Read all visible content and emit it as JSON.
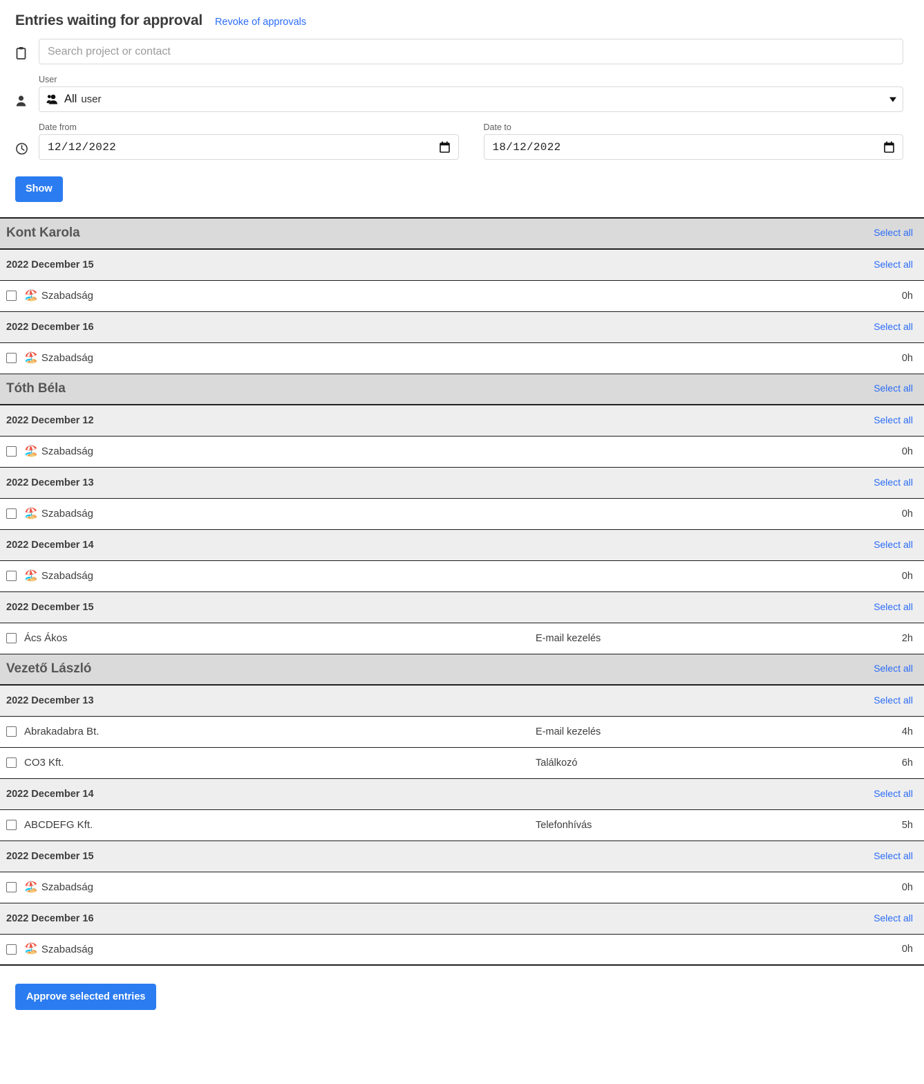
{
  "header": {
    "title": "Entries waiting for approval",
    "revoke_link": "Revoke of approvals"
  },
  "filters": {
    "search": {
      "icon": "clipboard-icon",
      "placeholder": "Search project or contact",
      "value": ""
    },
    "user": {
      "icon": "person-icon",
      "label": "User",
      "selected_prefix": "All",
      "selected_suffix": "user",
      "option_icon": "group-user-icon"
    },
    "dates": {
      "icon": "clock-icon",
      "from_label": "Date from",
      "from_value": "12/12/2022",
      "to_label": "Date to",
      "to_value": "18/12/2022",
      "calendar_icon": "calendar-icon"
    },
    "show_button": "Show"
  },
  "common": {
    "select_all": "Select all",
    "vacation_icon": "beach-umbrella-icon"
  },
  "groups": [
    {
      "user": "Kont Karola",
      "dates": [
        {
          "date": "2022 December 15",
          "entries": [
            {
              "icon": "beach-umbrella-icon",
              "name": "Szabadság",
              "task": "",
              "hours": "0h"
            }
          ]
        },
        {
          "date": "2022 December 16",
          "entries": [
            {
              "icon": "beach-umbrella-icon",
              "name": "Szabadság",
              "task": "",
              "hours": "0h"
            }
          ]
        }
      ]
    },
    {
      "user": "Tóth Béla",
      "dates": [
        {
          "date": "2022 December 12",
          "entries": [
            {
              "icon": "beach-umbrella-icon",
              "name": "Szabadság",
              "task": "",
              "hours": "0h"
            }
          ]
        },
        {
          "date": "2022 December 13",
          "entries": [
            {
              "icon": "beach-umbrella-icon",
              "name": "Szabadság",
              "task": "",
              "hours": "0h"
            }
          ]
        },
        {
          "date": "2022 December 14",
          "entries": [
            {
              "icon": "beach-umbrella-icon",
              "name": "Szabadság",
              "task": "",
              "hours": "0h"
            }
          ]
        },
        {
          "date": "2022 December 15",
          "entries": [
            {
              "icon": "",
              "name": "Ács Ákos",
              "task": "E-mail kezelés",
              "hours": "2h"
            }
          ]
        }
      ]
    },
    {
      "user": "Vezető László",
      "dates": [
        {
          "date": "2022 December 13",
          "entries": [
            {
              "icon": "",
              "name": "Abrakadabra Bt.",
              "task": "E-mail kezelés",
              "hours": "4h"
            },
            {
              "icon": "",
              "name": "CO3 Kft.",
              "task": "Találkozó",
              "hours": "6h"
            }
          ]
        },
        {
          "date": "2022 December 14",
          "entries": [
            {
              "icon": "",
              "name": "ABCDEFG Kft.",
              "task": "Telefonhívás",
              "hours": "5h"
            }
          ]
        },
        {
          "date": "2022 December 15",
          "entries": [
            {
              "icon": "beach-umbrella-icon",
              "name": "Szabadság",
              "task": "",
              "hours": "0h"
            }
          ]
        },
        {
          "date": "2022 December 16",
          "entries": [
            {
              "icon": "beach-umbrella-icon",
              "name": "Szabadság",
              "task": "",
              "hours": "0h"
            }
          ]
        }
      ]
    }
  ],
  "footer": {
    "approve_button": "Approve selected entries"
  },
  "colors": {
    "accent_blue": "#2b7cf0",
    "link_blue": "#2b6cf6",
    "user_header_bg": "#dadada",
    "date_header_bg": "#eeeeee"
  }
}
